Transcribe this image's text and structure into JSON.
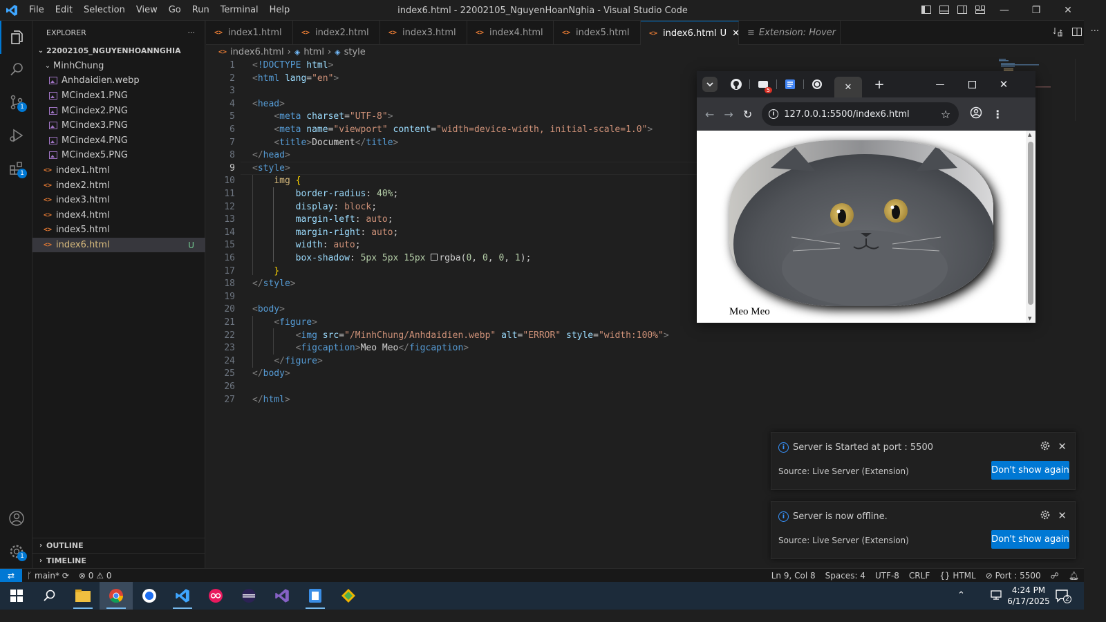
{
  "window": {
    "title": "index6.html - 22002105_NguyenHoanNghia - Visual Studio Code",
    "menu": [
      "File",
      "Edit",
      "Selection",
      "View",
      "Go",
      "Run",
      "Terminal",
      "Help"
    ]
  },
  "activity_bar": {
    "source_control_badge": "1",
    "extensions_badge": "1",
    "settings_badge": "1"
  },
  "sidebar": {
    "header": "EXPLORER",
    "more": "···",
    "root": "22002105_NGUYENHOANNGHIA",
    "folder": "MinhChung",
    "folder_files": [
      "Anhdaidien.webp",
      "MCindex1.PNG",
      "MCindex2.PNG",
      "MCindex3.PNG",
      "MCindex4.PNG",
      "MCindex5.PNG"
    ],
    "files": [
      "index1.html",
      "index2.html",
      "index3.html",
      "index4.html",
      "index5.html",
      "index6.html"
    ],
    "selected_status": "U",
    "outline": "OUTLINE",
    "timeline": "TIMELINE"
  },
  "tabs": [
    {
      "label": "index1.html"
    },
    {
      "label": "index2.html"
    },
    {
      "label": "index3.html"
    },
    {
      "label": "index4.html"
    },
    {
      "label": "index5.html"
    },
    {
      "label": "index6.html",
      "status": "U"
    },
    {
      "label": "Extension: Hover"
    }
  ],
  "breadcrumb": [
    "index6.html",
    "html",
    "style"
  ],
  "code": {
    "current_line": 9,
    "lines": [
      "<!DOCTYPE html>",
      "<html lang=\"en\">",
      "",
      "<head>",
      "    <meta charset=\"UTF-8\">",
      "    <meta name=\"viewport\" content=\"width=device-width, initial-scale=1.0\">",
      "    <title>Document</title>",
      "</head>",
      "<style>",
      "    img {",
      "        border-radius: 40%;",
      "        display: block;",
      "        margin-left: auto;",
      "        margin-right: auto;",
      "        width: auto;",
      "        box-shadow: 5px 5px 15px rgba(0, 0, 0, 1);",
      "    }",
      "</style>",
      "",
      "<body>",
      "    <figure>",
      "        <img src=\"/MinhChung/Anhdaidien.webp\" alt=\"ERROR\" style=\"width:100%\">",
      "        <figcaption>Meo Meo</figcaption>",
      "    </figure>",
      "</body>",
      "",
      "</html>"
    ]
  },
  "browser": {
    "url": "127.0.0.1:5500/index6.html",
    "tab_badge": "5",
    "figcaption": "Meo Meo"
  },
  "notifications": [
    {
      "message": "Server is Started at port : 5500",
      "source": "Source: Live Server (Extension)",
      "button": "Don't show again"
    },
    {
      "message": "Server is now offline.",
      "source": "Source: Live Server (Extension)",
      "button": "Don't show again"
    }
  ],
  "statusbar": {
    "branch": "main*",
    "errors": "0",
    "warnings": "0",
    "position": "Ln 9, Col 8",
    "spaces": "Spaces: 4",
    "encoding": "UTF-8",
    "eol": "CRLF",
    "language": "HTML",
    "port": "Port : 5500"
  },
  "taskbar": {
    "time": "4:24 PM",
    "date": "6/17/2025",
    "notification_count": "2"
  },
  "colors": {
    "accent": "#0078d4",
    "editor_bg": "#1f1f1f",
    "taskbar": "#1c2b3a"
  }
}
